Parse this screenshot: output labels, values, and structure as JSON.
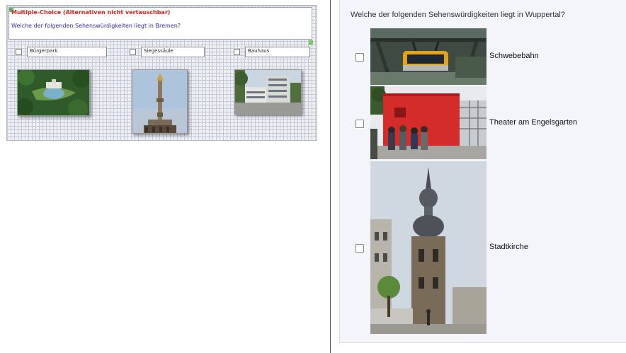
{
  "editor": {
    "question_type": "Multiple-Choice (Alternativen nicht vertauschbar)",
    "question_text": "Welche der folgenden Sehenswürdigkeiten liegt in Bremen?",
    "alternatives": [
      {
        "label": "Bürgerpark",
        "icon": "park-photo"
      },
      {
        "label": "Siegessäule",
        "icon": "column-photo"
      },
      {
        "label": "Bauhaus",
        "icon": "building-photo"
      }
    ]
  },
  "preview": {
    "question_text": "Welche der folgenden Sehenswürdigkeiten liegt in Wuppertal?",
    "options": [
      {
        "label": "Schwebebahn",
        "icon": "suspension-railway-photo"
      },
      {
        "label": "Theater am Engelsgarten",
        "icon": "red-theater-building-photo"
      },
      {
        "label": "Stadtkirche",
        "icon": "church-tower-photo"
      }
    ]
  },
  "colors": {
    "question_type": "#e02020",
    "question_text": "#2b2ba8",
    "grid_background": "#eef0f6",
    "preview_background": "#f4f5fb"
  }
}
